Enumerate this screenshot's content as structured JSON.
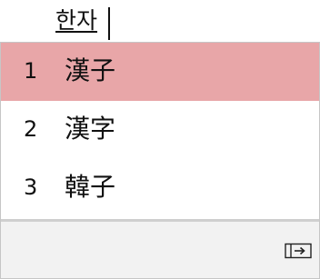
{
  "composition": {
    "text": "한자"
  },
  "candidates": [
    {
      "number": "1",
      "text": "漢子",
      "selected": true
    },
    {
      "number": "2",
      "text": "漢字",
      "selected": false
    },
    {
      "number": "3",
      "text": "韓子",
      "selected": false
    }
  ],
  "footer": {
    "expand_icon": "expand-candidates-icon"
  },
  "colors": {
    "selection": "#e8a6a8",
    "footer_bg": "#f2f2f2",
    "border": "#c6c6c6"
  }
}
